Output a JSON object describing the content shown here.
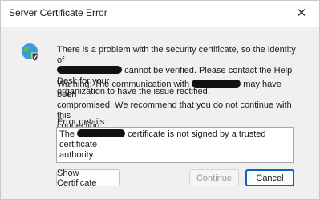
{
  "window": {
    "title": "Server Certificate Error"
  },
  "message": {
    "line1": "There is a problem with the security certificate, so the identity of",
    "line2_after": "cannot be verified. Please contact the Help Desk for your",
    "line3": "organization to have the issue rectified."
  },
  "warning": {
    "prefix": "Warning: The communication with",
    "line1_after": "may have been",
    "line2": "compromised. We recommend that you do not continue with this",
    "line3": "connection."
  },
  "details": {
    "label": "Error details:",
    "prefix": "The",
    "line1_after": "certificate is not signed by a trusted certificate",
    "line2": "authority."
  },
  "buttons": {
    "show_certificate": "Show Certificate",
    "continue": "Continue",
    "cancel": "Cancel"
  },
  "icons": {
    "close": "close-icon",
    "globe": "globe-shield-icon"
  },
  "colors": {
    "accent": "#0a64c8"
  }
}
